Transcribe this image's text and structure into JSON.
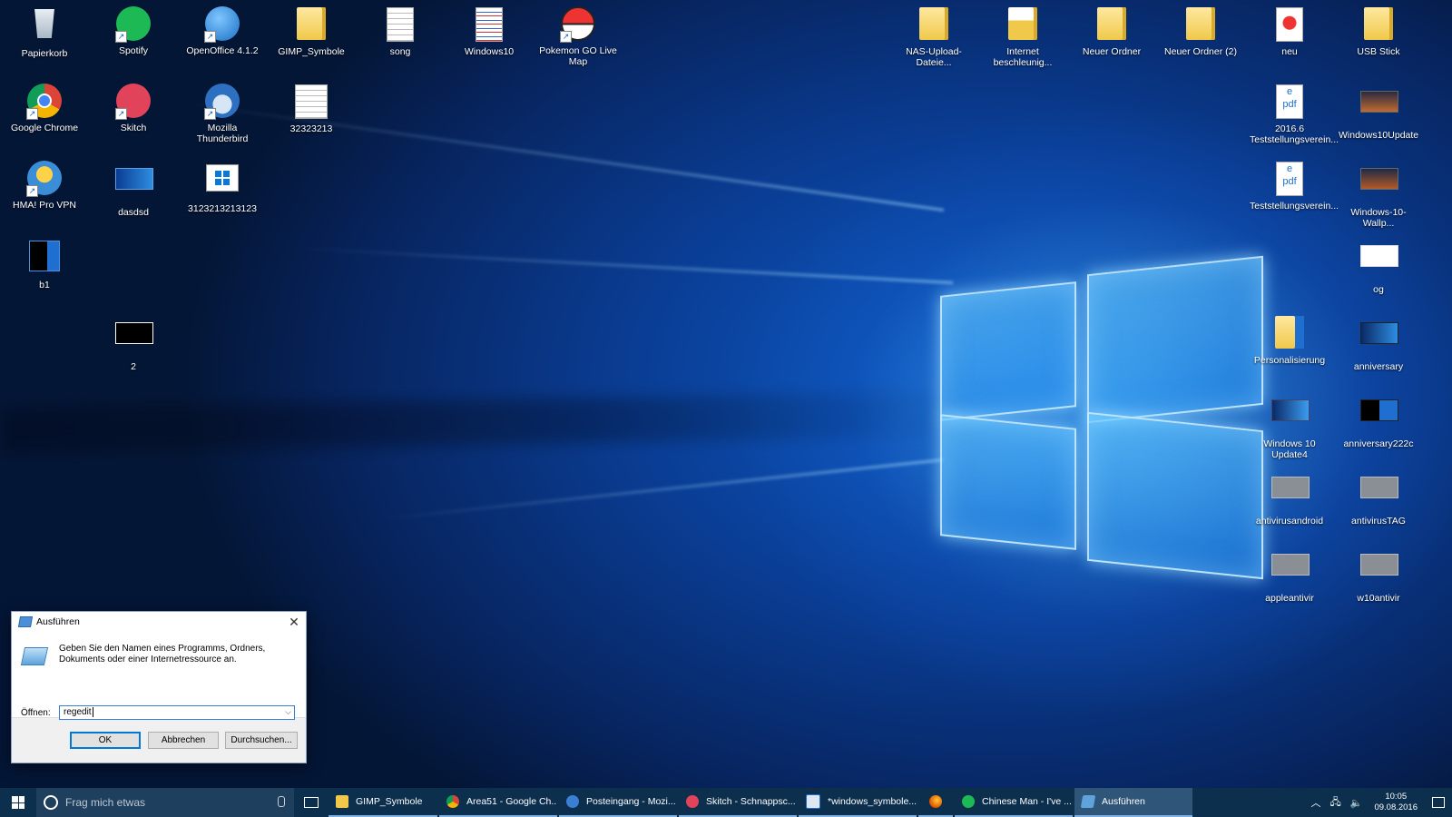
{
  "desktop": {
    "left_icons": [
      {
        "label": "Papierkorb",
        "icon": "recycle-bin-icon"
      },
      {
        "label": "Spotify",
        "icon": "spotify-icon"
      },
      {
        "label": "OpenOffice 4.1.2",
        "icon": "openoffice-icon"
      },
      {
        "label": "GIMP_Symbole",
        "icon": "folder-icon"
      },
      {
        "label": "song",
        "icon": "document-icon"
      },
      {
        "label": "Windows10",
        "icon": "document-icon"
      },
      {
        "label": "Pokemon GO Live Map",
        "icon": "pokeball-icon"
      },
      {
        "label": "Google Chrome",
        "icon": "chrome-icon"
      },
      {
        "label": "Skitch",
        "icon": "skitch-icon"
      },
      {
        "label": "Mozilla Thunderbird",
        "icon": "thunderbird-icon"
      },
      {
        "label": "32323213",
        "icon": "document-icon"
      },
      {
        "label": "HMA! Pro VPN",
        "icon": "vpn-icon"
      },
      {
        "label": "dasdsd",
        "icon": "image-icon"
      },
      {
        "label": "3123213213123",
        "icon": "windows-image-icon"
      },
      {
        "label": "b1",
        "icon": "image-icon"
      },
      {
        "label": "2",
        "icon": "image-icon"
      }
    ],
    "right_icons": [
      {
        "label": "NAS-Upload-Dateie...",
        "icon": "folder-icon"
      },
      {
        "label": "Internet beschleunig...",
        "icon": "folder-icon"
      },
      {
        "label": "Neuer Ordner",
        "icon": "folder-icon"
      },
      {
        "label": "Neuer Ordner (2)",
        "icon": "folder-icon"
      },
      {
        "label": "neu",
        "icon": "document-icon"
      },
      {
        "label": "USB Stick",
        "icon": "folder-icon"
      },
      {
        "label": "2016.6 Teststellungsverein...",
        "icon": "pdf-icon"
      },
      {
        "label": "Windows10Update",
        "icon": "image-icon"
      },
      {
        "label": "Teststellungsverein...",
        "icon": "pdf-icon"
      },
      {
        "label": "Windows-10-Wallp...",
        "icon": "image-icon"
      },
      {
        "label": "og",
        "icon": "image-icon"
      },
      {
        "label": "Personalisierung",
        "icon": "folder-icon"
      },
      {
        "label": "anniversary",
        "icon": "image-icon"
      },
      {
        "label": "Windows 10 Update4",
        "icon": "image-icon"
      },
      {
        "label": "anniversary222c",
        "icon": "image-icon"
      },
      {
        "label": "antivirusandroid",
        "icon": "image-icon"
      },
      {
        "label": "antivirusTAG",
        "icon": "image-icon"
      },
      {
        "label": "appleantivir",
        "icon": "image-icon"
      },
      {
        "label": "w10antivir",
        "icon": "image-icon"
      }
    ]
  },
  "run_dialog": {
    "title": "Ausführen",
    "message": "Geben Sie den Namen eines Programms, Ordners, Dokuments oder einer Internetressource an.",
    "open_label": "Öffnen:",
    "open_value": "regedit",
    "ok_label": "OK",
    "cancel_label": "Abbrechen",
    "browse_label": "Durchsuchen..."
  },
  "taskbar": {
    "search_placeholder": "Frag mich etwas",
    "items": [
      {
        "label": "GIMP_Symbole",
        "icon": "folder-icon",
        "color": "#f0c94a"
      },
      {
        "label": "Area51 - Google Ch...",
        "icon": "chrome-icon",
        "color": "#34a853"
      },
      {
        "label": "Posteingang - Mozi...",
        "icon": "thunderbird-icon",
        "color": "#3b7fd4"
      },
      {
        "label": "Skitch - Schnappsc...",
        "icon": "skitch-icon",
        "color": "#e0435a"
      },
      {
        "label": "*windows_symbole...",
        "icon": "paint-icon",
        "color": "#dfe7f2"
      },
      {
        "label": "",
        "icon": "firefox-icon",
        "color": "#e66000"
      },
      {
        "label": "Chinese Man - I've ...",
        "icon": "spotify-icon",
        "color": "#1db954"
      },
      {
        "label": "Ausführen",
        "icon": "run-icon",
        "color": "#5ea3dc"
      }
    ],
    "clock_time": "10:05",
    "clock_date": "09.08.2016"
  },
  "colors": {
    "taskbar_bg": "#0c2f4e",
    "accent": "#0078d7",
    "desktop_glow": "#56beff"
  }
}
